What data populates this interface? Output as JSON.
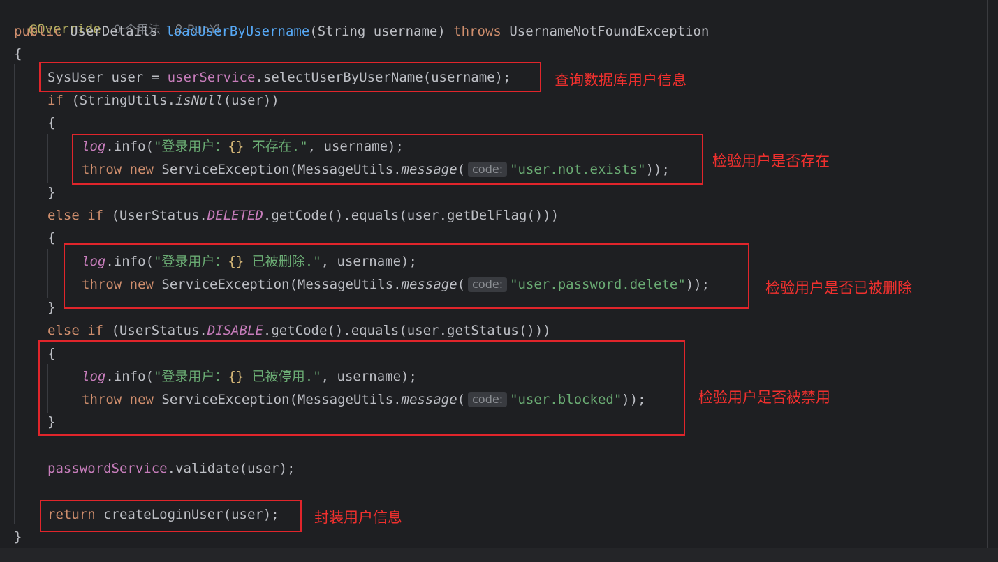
{
  "meta": {
    "annotation": "@Override",
    "usages": "0 个用法",
    "author": "RuoYi",
    "author_icon": "person-icon"
  },
  "code": {
    "sig_public": "public",
    "sig_type": "UserDetails",
    "sig_method": "loadUserByUsername",
    "sig_params": "(String username)",
    "sig_throws": "throws",
    "sig_exc": "UsernameNotFoundException",
    "open_brace": "{",
    "close_brace": "}",
    "l_sysuser_decl": "SysUser user = ",
    "l_sysuser_field": "userService",
    "l_sysuser_call": ".selectUserByUserName(username);",
    "if_kw": "if",
    "if_rest_a": " (StringUtils.",
    "if_isnull": "isNull",
    "if_rest_b": "(user))",
    "log": "log",
    "log_info": ".info(",
    "str_open": "\"登录用户：",
    "str_brace": "{}",
    "str_not_exist": " 不存在.\"",
    "str_deleted": " 已被删除.\"",
    "str_disabled": " 已被停用.\"",
    "log_tail": ", username);",
    "throw_kw": "throw",
    "new_kw": "new",
    "throw_a": " ServiceException(MessageUtils.",
    "message": "message",
    "paren_open": "(",
    "code_hint": "code:",
    "msg_not_exists": "\"user.not.exists\"",
    "msg_delete": "\"user.password.delete\"",
    "msg_blocked": "\"user.blocked\"",
    "throw_tail": "));",
    "else_kw": "else",
    "elseif_a": " (UserStatus.",
    "deleted": "DELETED",
    "disable": "DISABLE",
    "elseif_del_tail": ".getCode().equals(user.getDelFlag()))",
    "elseif_dis_tail": ".getCode().equals(user.getStatus()))",
    "pw_field": "passwordService",
    "pw_call": ".validate(user);",
    "return_kw": "return",
    "return_rest": " createLoginUser(user);"
  },
  "annotations": {
    "query_db": "查询数据库用户信息",
    "check_exists": "检验用户是否存在",
    "check_deleted": "检验用户是否已被删除",
    "check_disabled": "检验用户是否被禁用",
    "wrap_user": "封装用户信息"
  },
  "colors": {
    "background": "#1e1f22",
    "keyword": "#cf8e6d",
    "method": "#56a8f5",
    "field": "#c77dbb",
    "string": "#6aab73",
    "annotation_marker": "#e0252b"
  }
}
